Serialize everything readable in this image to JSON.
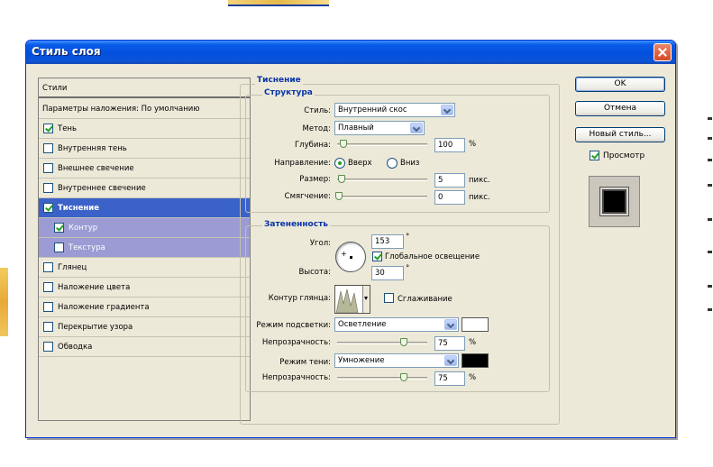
{
  "window": {
    "title": "Стиль слоя"
  },
  "styles_list": {
    "header": "Стили",
    "blending_options": "Параметры наложения: По умолчанию",
    "items": [
      {
        "label": "Тень",
        "checked": true
      },
      {
        "label": "Внутренняя тень",
        "checked": false
      },
      {
        "label": "Внешнее свечение",
        "checked": false
      },
      {
        "label": "Внутреннее свечение",
        "checked": false
      },
      {
        "label": "Тиснение",
        "checked": true
      },
      {
        "label": "Контур",
        "checked": true
      },
      {
        "label": "Текстура",
        "checked": false
      },
      {
        "label": "Глянец",
        "checked": false
      },
      {
        "label": "Наложение цвета",
        "checked": false
      },
      {
        "label": "Наложение градиента",
        "checked": false
      },
      {
        "label": "Перекрытие узора",
        "checked": false
      },
      {
        "label": "Обводка",
        "checked": false
      }
    ]
  },
  "emboss": {
    "title": "Тиснение",
    "structure": {
      "title": "Структура",
      "style_label": "Стиль:",
      "style_value": "Внутренний скос",
      "technique_label": "Метод:",
      "technique_value": "Плавный",
      "depth_label": "Глубина:",
      "depth_value": "100",
      "depth_unit": "%",
      "direction_label": "Направление:",
      "direction_up": "Вверх",
      "direction_down": "Вниз",
      "size_label": "Размер:",
      "size_value": "5",
      "size_unit": "пикс.",
      "soften_label": "Смягчение:",
      "soften_value": "0",
      "soften_unit": "пикс."
    },
    "shading": {
      "title": "Затененность",
      "angle_label": "Угол:",
      "angle_value": "153",
      "angle_unit": "°",
      "global_light_label": "Глобальное освещение",
      "altitude_label": "Высота:",
      "altitude_value": "30",
      "altitude_unit": "°",
      "gloss_contour_label": "Контур глянца:",
      "antialias_label": "Сглаживание",
      "highlight_mode_label": "Режим подсветки:",
      "highlight_mode_value": "Осветление",
      "highlight_color": "#ffffff",
      "highlight_opacity_label": "Непрозрачность:",
      "highlight_opacity_value": "75",
      "highlight_opacity_unit": "%",
      "shadow_mode_label": "Режим тени:",
      "shadow_mode_value": "Умножение",
      "shadow_color": "#000000",
      "shadow_opacity_label": "Непрозрачность:",
      "shadow_opacity_value": "75",
      "shadow_opacity_unit": "%"
    }
  },
  "buttons": {
    "ok": "OK",
    "cancel": "Отмена",
    "new_style": "Новый стиль...",
    "preview_label": "Просмотр"
  }
}
